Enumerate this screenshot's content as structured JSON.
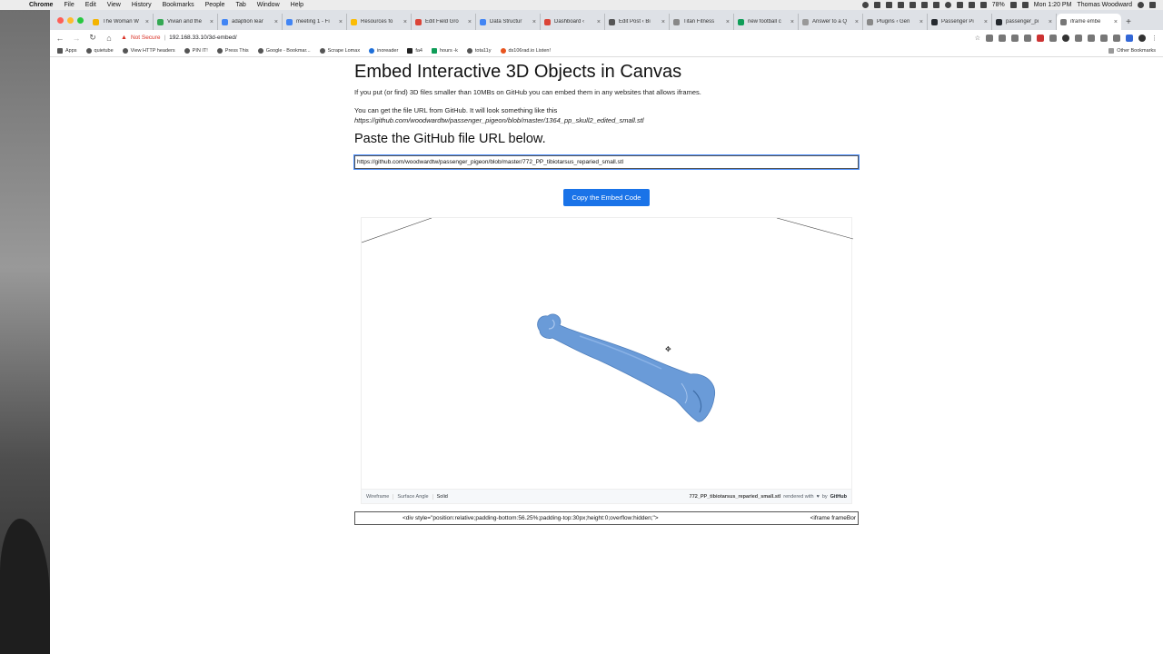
{
  "menubar": {
    "apple_glyph": "",
    "app": "Chrome",
    "items": [
      "File",
      "Edit",
      "View",
      "History",
      "Bookmarks",
      "People",
      "Tab",
      "Window",
      "Help"
    ],
    "battery": "78%",
    "clock": "Mon 1:20 PM",
    "user": "Thomas Woodward"
  },
  "tabs": [
    {
      "label": "The Woman W",
      "color": "#f4b400"
    },
    {
      "label": "Vivian and the",
      "color": "#34a853"
    },
    {
      "label": "adaption lear",
      "color": "#4285f4"
    },
    {
      "label": "meeting 1 - Fi",
      "color": "#4285f4"
    },
    {
      "label": "Resources fo",
      "color": "#fbbc04"
    },
    {
      "label": "Edit Field Gro",
      "color": "#db4437"
    },
    {
      "label": "Data Structur",
      "color": "#4285f4"
    },
    {
      "label": "Dashboard ‹",
      "color": "#db4437"
    },
    {
      "label": "Edit Post ‹ Bi",
      "color": "#555555"
    },
    {
      "label": "Titan Fitness",
      "color": "#888888"
    },
    {
      "label": "new football c",
      "color": "#0f9d58"
    },
    {
      "label": "Answer to a Q",
      "color": "#999999"
    },
    {
      "label": "Plugins ‹ Gen",
      "color": "#888888"
    },
    {
      "label": "Passenger Pi",
      "color": "#24292e"
    },
    {
      "label": "passenger_pi",
      "color": "#24292e"
    },
    {
      "label": "iframe embe",
      "color": "#777777",
      "active": true
    }
  ],
  "toolbar": {
    "security": "Not Secure",
    "url": "192.168.33.10/3d-embed/"
  },
  "bookmarks": {
    "items": [
      "Apps",
      "quietube",
      "View HTTP headers",
      "PIN IT!",
      "Press This",
      "Google - Bookmar...",
      "Scrape Lomax",
      "inoreader",
      "fa4",
      "hours -k",
      "tota11y",
      "ds106rad.io Listen!"
    ],
    "other": "Other Bookmarks"
  },
  "main": {
    "title": "Embed Interactive 3D Objects in Canvas",
    "intro": "If you put (or find) 3D files smaller than 10MBs on GitHub you can embed them in any websites that allows iframes.",
    "hint": "You can get the file URL from GitHub. It will look something like this",
    "example_url": "https://github.com/woodwardtw/passenger_pigeon/blob/master/1364_pp_skull2_edited_small.stl",
    "subtitle": "Paste the GitHub file URL below.",
    "url_value": "https://github.com/woodwardtw/passenger_pigeon/blob/master/772_PP_tibiotarsus_reparied_small.stl",
    "copy_button": "Copy the Embed Code",
    "embed_code_start": "<div style=\"position:relative;padding-bottom:56.25%;padding-top:30px;height:0;overflow:hidden;\">",
    "embed_code_end": "<iframe frameBor"
  },
  "viewer": {
    "modes": [
      "Wireframe",
      "Surface Angle",
      "Solid"
    ],
    "active_mode": "Solid",
    "filename": "772_PP_tibiotarsus_reparied_small.stl",
    "rendered_with": "rendered with",
    "by": "by",
    "github": "GitHub",
    "model_color": "#6a9bd8"
  }
}
